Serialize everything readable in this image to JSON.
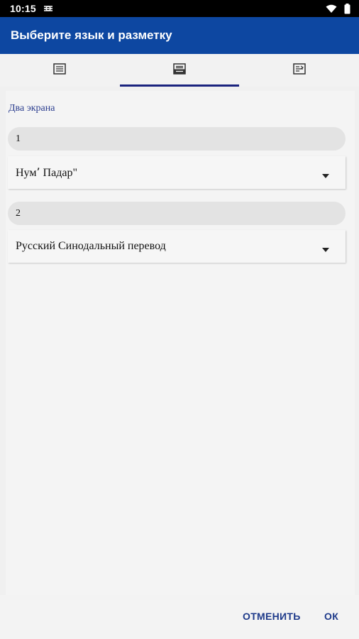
{
  "status_bar": {
    "time": "10:15",
    "icons": [
      "sync-icon",
      "wifi-icon",
      "battery-icon"
    ]
  },
  "dialog": {
    "title": "Выберите язык и разметку"
  },
  "tabs": [
    {
      "icon": "single-page-icon",
      "active": false
    },
    {
      "icon": "two-pane-icon",
      "active": true
    },
    {
      "icon": "parallel-layout-icon",
      "active": false
    }
  ],
  "layout": {
    "section_title": "Два экрана",
    "panes": [
      {
        "label": "1",
        "selected": "Нум՚ Падар\""
      },
      {
        "label": "2",
        "selected": "Русский Синодальный перевод"
      }
    ]
  },
  "footer": {
    "cancel_label": "ОТМЕНИТЬ",
    "ok_label": "ОК"
  },
  "colors": {
    "app_bar": "#0d47a1",
    "accent": "#1a237e",
    "button_text": "#1e3a8a"
  }
}
